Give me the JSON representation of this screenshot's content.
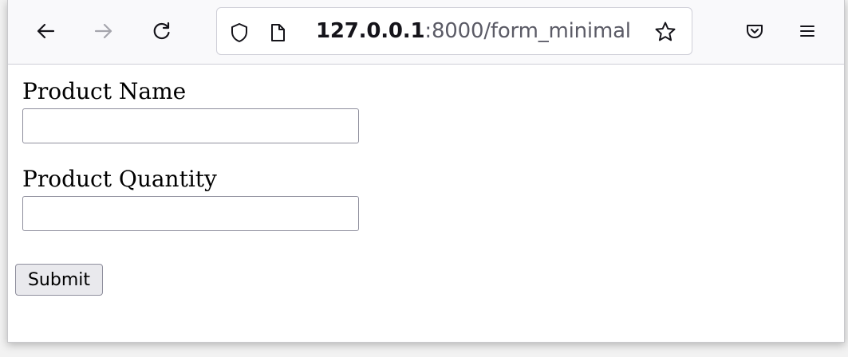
{
  "browser": {
    "url_host": "127.0.0.1",
    "url_rest": ":8000/form_minimal",
    "icons": {
      "back": "back-arrow-icon",
      "forward": "forward-arrow-icon",
      "reload": "reload-icon",
      "shield": "shield-icon",
      "page": "page-icon",
      "bookmark": "star-icon",
      "pocket": "pocket-icon",
      "menu": "hamburger-menu-icon"
    }
  },
  "form": {
    "product_name_label": "Product Name",
    "product_name_value": "",
    "product_quantity_label": "Product Quantity",
    "product_quantity_value": "",
    "submit_label": "Submit"
  }
}
